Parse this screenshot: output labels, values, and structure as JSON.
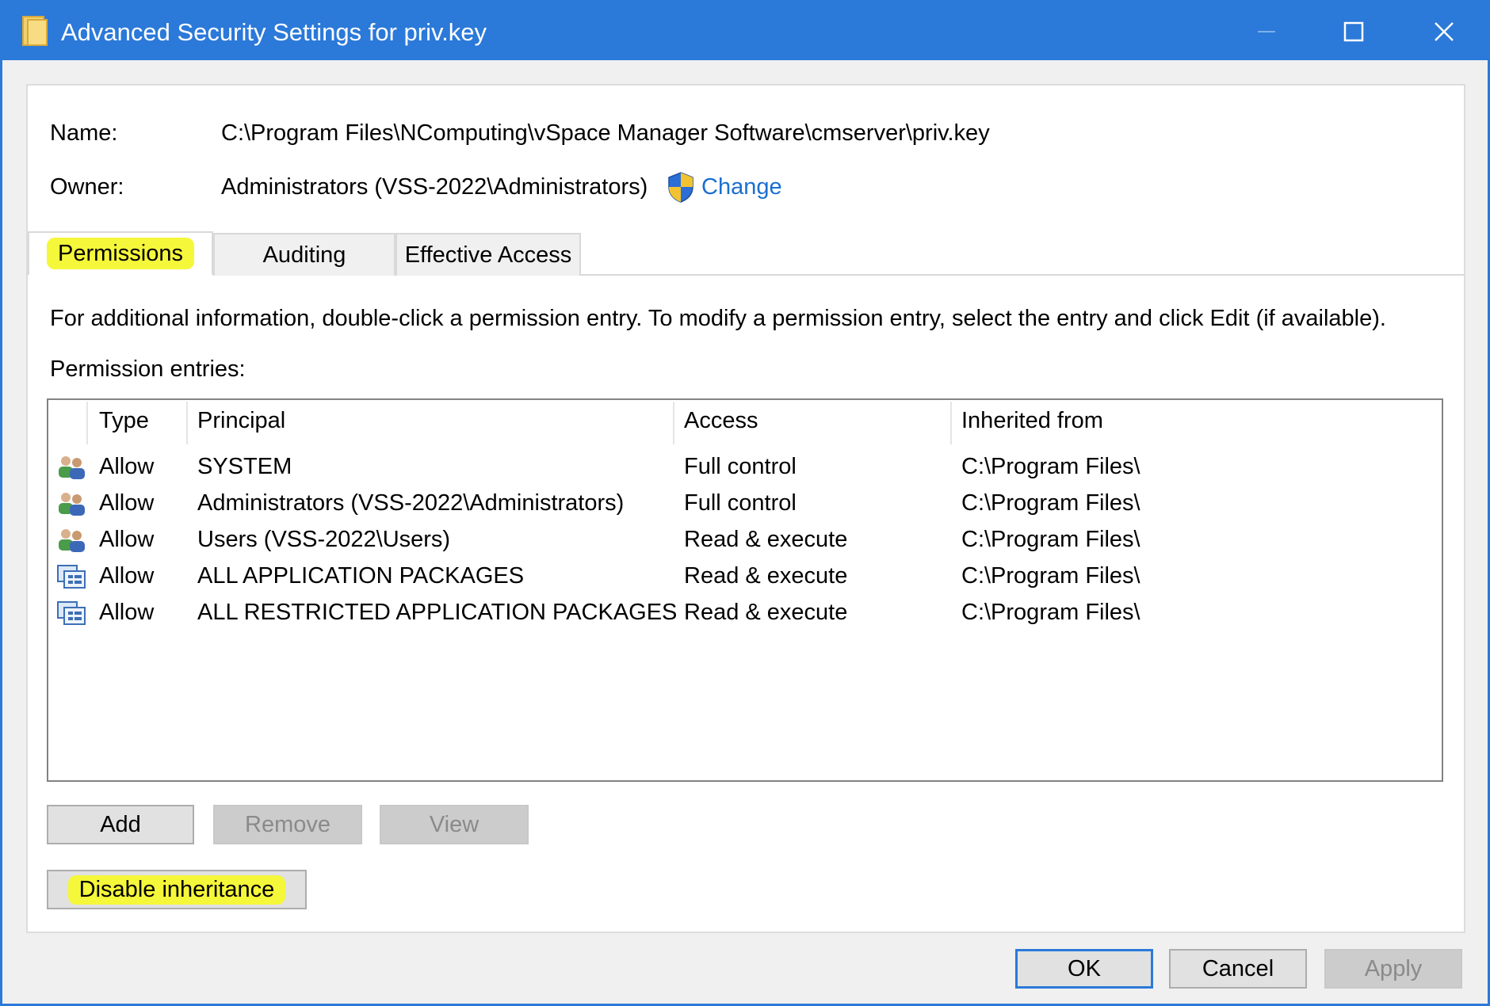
{
  "window": {
    "title": "Advanced Security Settings for priv.key",
    "controls": {
      "minimize": "minimize",
      "maximize": "maximize",
      "close": "close"
    }
  },
  "header": {
    "name_label": "Name:",
    "name_value": "C:\\Program Files\\NComputing\\vSpace Manager Software\\cmserver\\priv.key",
    "owner_label": "Owner:",
    "owner_value": "Administrators (VSS-2022\\Administrators)",
    "change_link": "Change"
  },
  "tabs": [
    {
      "label": "Permissions",
      "active": true,
      "highlighted": true
    },
    {
      "label": "Auditing",
      "active": false
    },
    {
      "label": "Effective Access",
      "active": false
    }
  ],
  "info_text": "For additional information, double-click a permission entry. To modify a permission entry, select the entry and click Edit (if available).",
  "entries_label": "Permission entries:",
  "table": {
    "columns": [
      "Type",
      "Principal",
      "Access",
      "Inherited from"
    ],
    "rows": [
      {
        "icon": "users-icon",
        "type": "Allow",
        "principal": "SYSTEM",
        "access": "Full control",
        "inherited": "C:\\Program Files\\"
      },
      {
        "icon": "users-icon",
        "type": "Allow",
        "principal": "Administrators (VSS-2022\\Administrators)",
        "access": "Full control",
        "inherited": "C:\\Program Files\\"
      },
      {
        "icon": "users-icon",
        "type": "Allow",
        "principal": "Users (VSS-2022\\Users)",
        "access": "Read & execute",
        "inherited": "C:\\Program Files\\"
      },
      {
        "icon": "app-packages-icon",
        "type": "Allow",
        "principal": "ALL APPLICATION PACKAGES",
        "access": "Read & execute",
        "inherited": "C:\\Program Files\\"
      },
      {
        "icon": "app-packages-icon",
        "type": "Allow",
        "principal": "ALL RESTRICTED APPLICATION PACKAGES",
        "access": "Read & execute",
        "inherited": "C:\\Program Files\\"
      }
    ]
  },
  "buttons": {
    "add": "Add",
    "remove": "Remove",
    "view": "View",
    "disable_inheritance": "Disable inheritance",
    "ok": "OK",
    "cancel": "Cancel",
    "apply": "Apply"
  },
  "colors": {
    "titlebar": "#2b79d9",
    "highlight": "#f5f73a",
    "link": "#1a6fd1"
  }
}
